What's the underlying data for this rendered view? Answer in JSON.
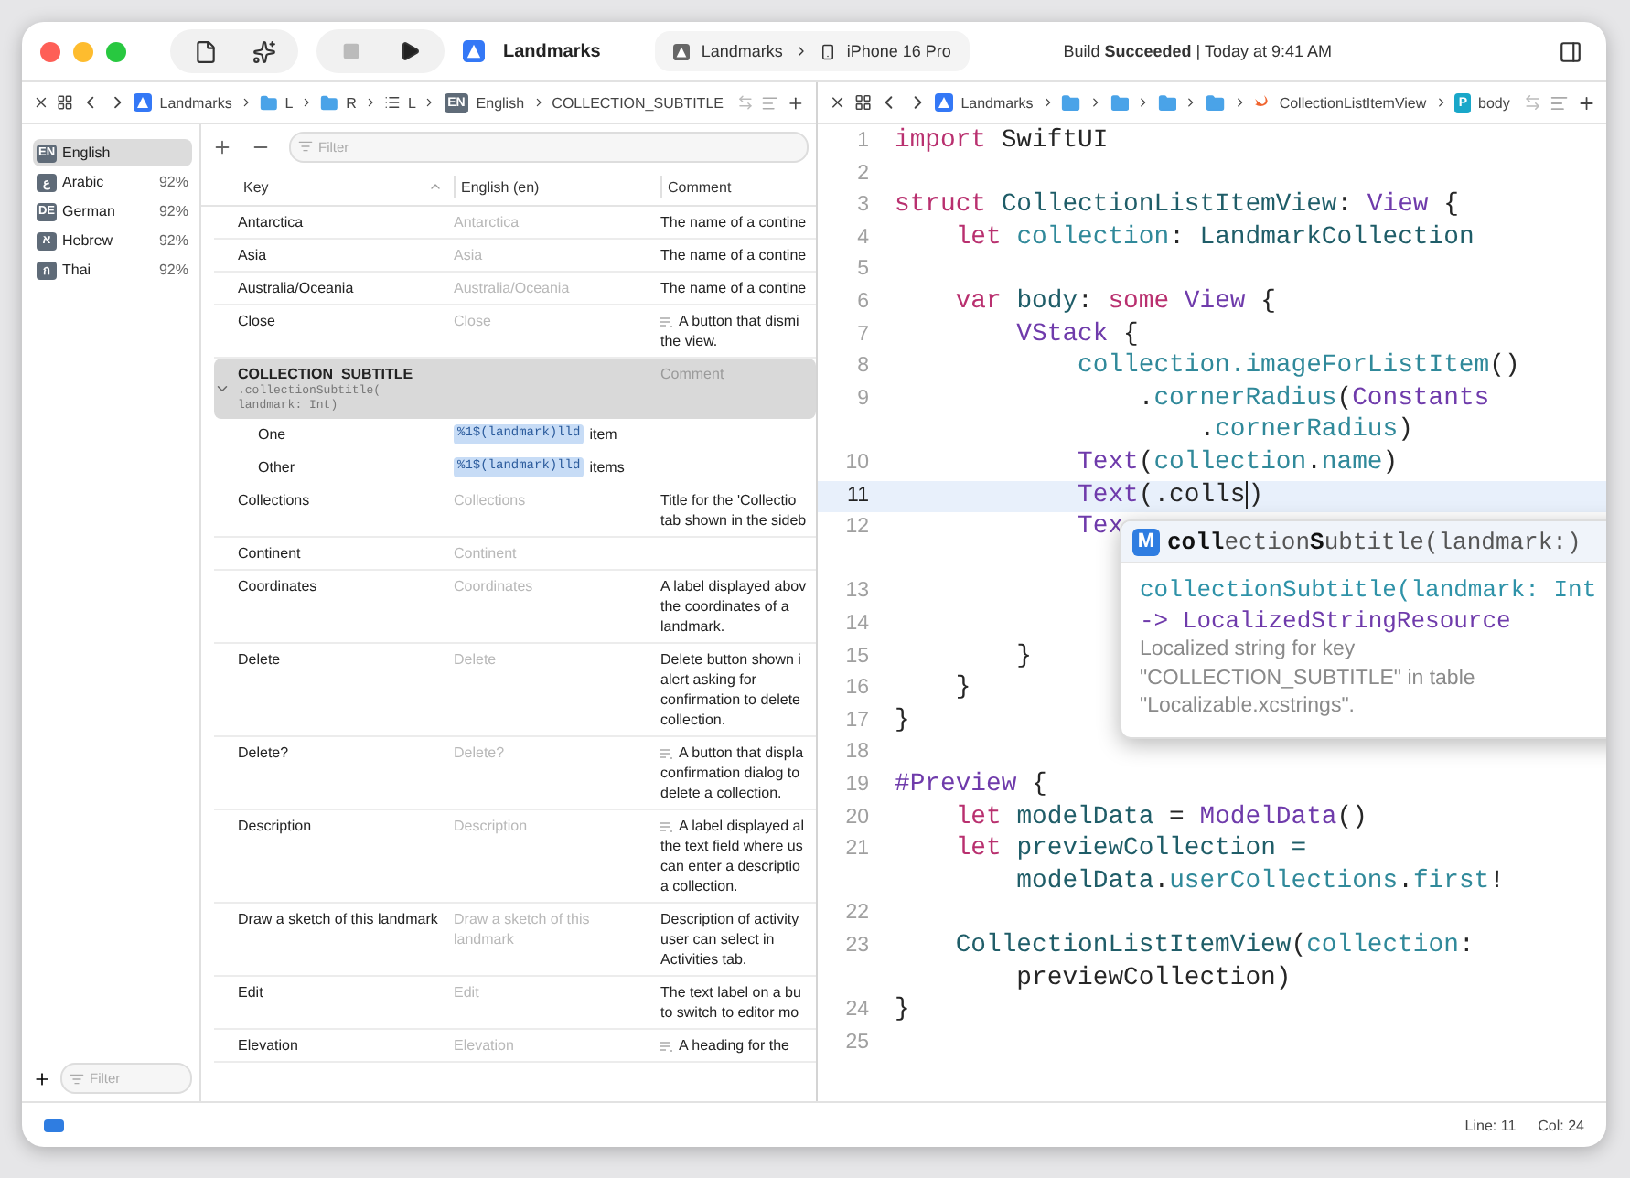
{
  "toolbar": {
    "scheme": "Landmarks",
    "destination_project": "Landmarks",
    "destination_device": "iPhone 16 Pro",
    "status": "Build **Succeeded** | Today at 9:41 AM"
  },
  "left_jump_bar": {
    "items": [
      {
        "kind": "app",
        "label": "Landmarks"
      },
      {
        "kind": "folder",
        "label": "L"
      },
      {
        "kind": "folder",
        "label": "R"
      },
      {
        "kind": "list",
        "label": "L"
      },
      {
        "kind": "badge",
        "badge": "EN",
        "label": "English"
      },
      {
        "kind": "plain",
        "label": "COLLECTION_SUBTITLE"
      }
    ]
  },
  "right_jump_bar": {
    "items": [
      {
        "kind": "app",
        "label": "Landmarks"
      },
      {
        "kind": "folder"
      },
      {
        "kind": "folder"
      },
      {
        "kind": "folder"
      },
      {
        "kind": "folder"
      },
      {
        "kind": "swift",
        "label": "CollectionListItemView"
      },
      {
        "kind": "badge",
        "badge": "P",
        "label": "body"
      }
    ]
  },
  "languages": [
    {
      "code": "EN",
      "name": "English",
      "selected": true
    },
    {
      "code": "ع",
      "name": "Arabic",
      "percent": "92%",
      "selected": false
    },
    {
      "code": "DE",
      "name": "German",
      "percent": "92%",
      "selected": false
    },
    {
      "code": "א",
      "name": "Hebrew",
      "percent": "92%",
      "selected": false
    },
    {
      "code": "ก",
      "name": "Thai",
      "percent": "92%",
      "selected": false
    }
  ],
  "language_filter": {
    "placeholder": "Filter"
  },
  "string_table": {
    "filter": {
      "placeholder": "Filter"
    },
    "columns": [
      {
        "label": "Key",
        "sorted": true
      },
      {
        "label": "English (en)",
        "sorted": false
      },
      {
        "label": "Comment",
        "sorted": false
      }
    ],
    "rows": [
      {
        "kind": "string",
        "key": "Antarctica",
        "value": "Antarctica",
        "comment": [
          "The name of a contine"
        ],
        "extracted": false,
        "selected": false
      },
      {
        "kind": "string",
        "key": "Asia",
        "value": "Asia",
        "comment": [
          "The name of a contine"
        ],
        "extracted": false,
        "selected": false
      },
      {
        "kind": "string",
        "key": "Australia/Oceania",
        "value": "Australia/Oceania",
        "comment": [
          "The name of a contine"
        ],
        "extracted": false,
        "selected": false
      },
      {
        "kind": "string",
        "key": "Close",
        "value": "Close",
        "comment": [
          "A button that dismi",
          "the view."
        ],
        "extracted": true,
        "selected": false
      },
      {
        "kind": "group",
        "key": "COLLECTION_SUBTITLE",
        "symbol": [
          ".collectionSubtitle(",
          "landmark: Int)"
        ],
        "comment_placeholder": "Comment",
        "expanded": true,
        "selected": true,
        "children": [
          {
            "key": "One",
            "token": "%1$(landmark)lld",
            "suffix": "item"
          },
          {
            "key": "Other",
            "token": "%1$(landmark)lld",
            "suffix": "items"
          }
        ]
      },
      {
        "kind": "string",
        "key": "Collections",
        "value": "Collections",
        "comment": [
          "Title for the 'Collectio",
          "tab shown in the sideb"
        ],
        "extracted": false,
        "selected": false
      },
      {
        "kind": "string",
        "key": "Continent",
        "value": "Continent",
        "selected": false
      },
      {
        "kind": "string",
        "key": "Coordinates",
        "value": "Coordinates",
        "comment": [
          "A label displayed abov",
          "the coordinates of a",
          "landmark."
        ],
        "extracted": false,
        "selected": false
      },
      {
        "kind": "string",
        "key": "Delete",
        "value": "Delete",
        "comment": [
          "Delete button shown i",
          "alert asking for",
          "confirmation to delete",
          "collection."
        ],
        "extracted": false,
        "selected": false
      },
      {
        "kind": "string",
        "key": "Delete?",
        "value": "Delete?",
        "comment": [
          "A button that displa",
          "confirmation dialog to",
          "delete a collection."
        ],
        "extracted": true,
        "selected": false
      },
      {
        "kind": "string",
        "key": "Description",
        "value": "Description",
        "comment": [
          "A label displayed al",
          "the text field where us",
          "can enter a descriptio",
          "a collection."
        ],
        "extracted": true,
        "selected": false
      },
      {
        "kind": "string",
        "key": "Draw a sketch of this landmark",
        "value": "Draw a sketch of this landmark",
        "comment": [
          "Description of activity",
          "user can select in",
          "Activities tab."
        ],
        "extracted": false,
        "selected": false
      },
      {
        "kind": "string",
        "key": "Edit",
        "value": "Edit",
        "comment": [
          "The text label on a bu",
          "to switch to editor mo"
        ],
        "extracted": false,
        "selected": false
      },
      {
        "kind": "string",
        "key": "Elevation",
        "value": "Elevation",
        "comment": [
          "A heading for the"
        ],
        "extracted": true,
        "selected": false
      }
    ]
  },
  "editor": {
    "lines": [
      {
        "number": "1",
        "current": false,
        "visual_lines": [
          {
            "tokens": [
              {
                "text": "import",
                "kind": "kw"
              },
              {
                "text": " SwiftUI",
                "kind": "plain"
              }
            ]
          }
        ]
      },
      {
        "number": "2",
        "current": false
      },
      {
        "number": "3",
        "current": false,
        "visual_lines": [
          {
            "tokens": [
              {
                "text": "struct",
                "kind": "kw"
              },
              {
                "text": " CollectionListItemView",
                "kind": "decl"
              },
              {
                "text": ": ",
                "kind": "plain"
              },
              {
                "text": "View",
                "kind": "type"
              },
              {
                "text": " {",
                "kind": "plain"
              }
            ]
          }
        ]
      },
      {
        "number": "4",
        "current": false,
        "visual_lines": [
          {
            "tokens": [
              {
                "text": "    let",
                "kind": "kw"
              },
              {
                "text": " collection",
                "kind": "member"
              },
              {
                "text": ": ",
                "kind": "plain"
              },
              {
                "text": "LandmarkCollection",
                "kind": "decl"
              }
            ]
          }
        ]
      },
      {
        "number": "5",
        "current": false
      },
      {
        "number": "6",
        "current": false,
        "visual_lines": [
          {
            "tokens": [
              {
                "text": "    var",
                "kind": "kw"
              },
              {
                "text": " body",
                "kind": "decl"
              },
              {
                "text": ": ",
                "kind": "plain"
              },
              {
                "text": "some",
                "kind": "kw"
              },
              {
                "text": " View",
                "kind": "type"
              },
              {
                "text": " {",
                "kind": "plain"
              }
            ]
          }
        ]
      },
      {
        "number": "7",
        "current": false,
        "visual_lines": [
          {
            "tokens": [
              {
                "text": "        VStack",
                "kind": "type"
              },
              {
                "text": " {",
                "kind": "plain"
              }
            ]
          }
        ]
      },
      {
        "number": "8",
        "current": false,
        "visual_lines": [
          {
            "tokens": [
              {
                "text": "            collection",
                "kind": "member"
              },
              {
                "text": ".imageForListItem",
                "kind": "member"
              },
              {
                "text": "()",
                "kind": "plain"
              }
            ]
          }
        ]
      },
      {
        "number": "9",
        "current": false,
        "visual_lines": [
          {
            "tokens": [
              {
                "text": "                .",
                "kind": "plain"
              },
              {
                "text": "cornerRadius",
                "kind": "member"
              },
              {
                "text": "(",
                "kind": "plain"
              },
              {
                "text": "Constants",
                "kind": "type"
              }
            ]
          },
          {
            "tokens": [
              {
                "text": "                    .",
                "kind": "plain"
              },
              {
                "text": "cornerRadius",
                "kind": "member"
              },
              {
                "text": ")",
                "kind": "plain"
              }
            ]
          }
        ]
      },
      {
        "number": "10",
        "current": false,
        "visual_lines": [
          {
            "tokens": [
              {
                "text": "            Text",
                "kind": "type"
              },
              {
                "text": "(",
                "kind": "plain"
              },
              {
                "text": "collection",
                "kind": "member"
              },
              {
                "text": ".",
                "kind": "plain"
              },
              {
                "text": "name",
                "kind": "member"
              },
              {
                "text": ")",
                "kind": "plain"
              }
            ]
          }
        ]
      },
      {
        "number": "11",
        "current": true,
        "visual_lines": [
          {
            "tokens": [
              {
                "text": "            Text",
                "kind": "type"
              },
              {
                "text": "(.colls",
                "kind": "plain",
                "caret": true
              },
              {
                "text": ")",
                "kind": "plain"
              }
            ]
          }
        ]
      },
      {
        "number": "12",
        "current": false,
        "wrapped": true,
        "visual_lines": [
          {
            "tokens": [
              {
                "text": "            Tex",
                "kind": "type"
              }
            ]
          }
        ]
      },
      {
        "number": "13",
        "current": false
      },
      {
        "number": "14",
        "current": false
      },
      {
        "number": "15",
        "current": false,
        "visual_lines": [
          {
            "tokens": [
              {
                "text": "        }",
                "kind": "plain"
              }
            ]
          }
        ]
      },
      {
        "number": "16",
        "current": false,
        "visual_lines": [
          {
            "tokens": [
              {
                "text": "    }",
                "kind": "plain"
              }
            ]
          }
        ]
      },
      {
        "number": "17",
        "current": false,
        "visual_lines": [
          {
            "tokens": [
              {
                "text": "}",
                "kind": "plain"
              }
            ]
          }
        ]
      },
      {
        "number": "18",
        "current": false
      },
      {
        "number": "19",
        "current": false,
        "visual_lines": [
          {
            "tokens": [
              {
                "text": "#Preview",
                "kind": "type"
              },
              {
                "text": " {",
                "kind": "plain"
              }
            ]
          }
        ]
      },
      {
        "number": "20",
        "current": false,
        "visual_lines": [
          {
            "tokens": [
              {
                "text": "    let",
                "kind": "kw"
              },
              {
                "text": " modelData",
                "kind": "decl"
              },
              {
                "text": " = ",
                "kind": "plain"
              },
              {
                "text": "ModelData",
                "kind": "type"
              },
              {
                "text": "()",
                "kind": "plain"
              }
            ]
          }
        ]
      },
      {
        "number": "21",
        "current": false,
        "visual_lines": [
          {
            "tokens": [
              {
                "text": "    let",
                "kind": "kw"
              },
              {
                "text": " previewCollection =",
                "kind": "decl"
              }
            ]
          },
          {
            "tokens": [
              {
                "text": "        modelData",
                "kind": "decl"
              },
              {
                "text": ".",
                "kind": "plain"
              },
              {
                "text": "userCollections",
                "kind": "member"
              },
              {
                "text": ".",
                "kind": "plain"
              },
              {
                "text": "first",
                "kind": "member"
              },
              {
                "text": "!",
                "kind": "plain"
              }
            ]
          }
        ]
      },
      {
        "number": "22",
        "current": false
      },
      {
        "number": "23",
        "current": false,
        "visual_lines": [
          {
            "tokens": [
              {
                "text": "    CollectionListItemView",
                "kind": "decl"
              },
              {
                "text": "(",
                "kind": "plain"
              },
              {
                "text": "collection",
                "kind": "member"
              },
              {
                "text": ":",
                "kind": "plain"
              }
            ]
          },
          {
            "tokens": [
              {
                "text": "        previewCollection)",
                "kind": "plain"
              }
            ]
          }
        ]
      },
      {
        "number": "24",
        "current": false,
        "visual_lines": [
          {
            "tokens": [
              {
                "text": "}",
                "kind": "plain"
              }
            ]
          }
        ]
      },
      {
        "number": "25",
        "current": false
      }
    ],
    "completion": {
      "badge": "M",
      "title": "**coll**ection**S**ubtitle(landmark:)",
      "signature": "collectionSubtitle(landmark: Int",
      "returns": "-> LocalizedStringResource",
      "description": [
        "Localized string for key",
        "\"COLLECTION_SUBTITLE\" in table",
        "\"Localizable.xcstrings\"."
      ]
    }
  },
  "status_bar": {
    "line": "Line: 11",
    "column": "Col: 24"
  }
}
